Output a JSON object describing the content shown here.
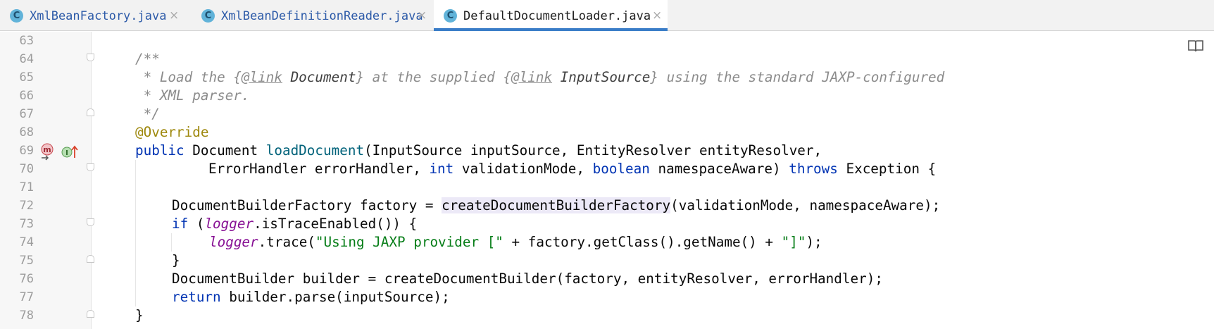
{
  "tabs": [
    {
      "icon_letter": "C",
      "label": "XmlBeanFactory.java",
      "active": false
    },
    {
      "icon_letter": "C",
      "label": "XmlBeanDefinitionReader.java",
      "active": false
    },
    {
      "icon_letter": "C",
      "label": "DefaultDocumentLoader.java",
      "active": true
    }
  ],
  "tab_close_glyph": "×",
  "gutter": {
    "line_numbers": [
      "63",
      "64",
      "65",
      "66",
      "67",
      "68",
      "69",
      "70",
      "71",
      "72",
      "73",
      "74",
      "75",
      "76",
      "77",
      "78"
    ],
    "line_69_icons": [
      "method-icon",
      "implements-interface-icon"
    ]
  },
  "code": {
    "l64": "/**",
    "l65": {
      "t1": " * Load the {",
      "tag1": "@link",
      "ref1": " Document",
      "t2": "} at the supplied {",
      "tag2": "@link",
      "ref2": " InputSource",
      "t3": "} using the standard JAXP-configured"
    },
    "l66": " * XML parser.",
    "l67": " */",
    "l68": "@Override",
    "l69": {
      "kw_public": "public",
      "t1": " Document ",
      "fn": "loadDocument",
      "t2": "(InputSource inputSource, EntityResolver entityResolver,"
    },
    "l70": {
      "t1": "ErrorHandler errorHandler, ",
      "kw_int": "int",
      "t2": " validationMode, ",
      "kw_boolean": "boolean",
      "t3": " namespaceAware) ",
      "kw_throws": "throws",
      "t4": " Exception {"
    },
    "l72": {
      "t1": "DocumentBuilderFactory factory = ",
      "hl": "createDocumentBuilderFactory",
      "t2": "(validationMode, namespaceAware);"
    },
    "l73": {
      "kw_if": "if",
      "t1": " (",
      "field": "logger",
      "t2": ".isTraceEnabled()) {"
    },
    "l74": {
      "field": "logger",
      "t1": ".trace(",
      "str1": "\"Using JAXP provider [\"",
      "t2": " + factory.getClass().getName() + ",
      "str2": "\"]\"",
      "t3": ");"
    },
    "l75": "}",
    "l76": "DocumentBuilder builder = createDocumentBuilder(factory, entityResolver, errorHandler);",
    "l77": {
      "kw_return": "return",
      "t1": " builder.parse(inputSource);"
    },
    "l78": "}"
  },
  "colors": {
    "keyword": "#0033b3",
    "method_declaration": "#00627a",
    "field": "#871094",
    "string": "#067d17",
    "comment": "#8c8c8c",
    "annotation": "#9e880d",
    "active_tab_underline": "#3a7dc8",
    "identifier_highlight": "#ece9f7"
  }
}
